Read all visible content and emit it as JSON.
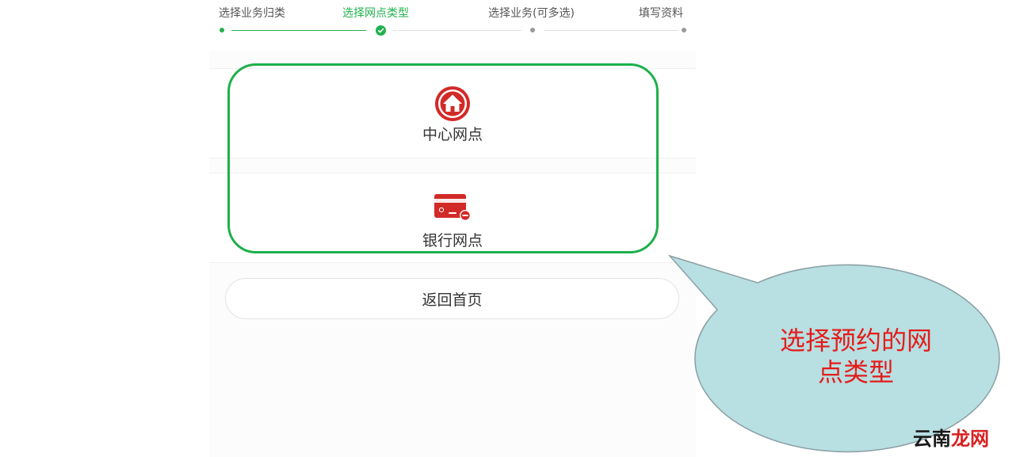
{
  "steps": [
    {
      "label": "选择业务归类",
      "state": "done"
    },
    {
      "label": "选择网点类型",
      "state": "active"
    },
    {
      "label": "选择业务(可多选)",
      "state": "pending"
    },
    {
      "label": "填写资料",
      "state": "pending"
    }
  ],
  "options": [
    {
      "label": "中心网点",
      "icon": "home-icon"
    },
    {
      "label": "银行网点",
      "icon": "bank-card-icon"
    }
  ],
  "home_button": {
    "label": "返回首页"
  },
  "annotation": {
    "text_line1": "选择预约的网",
    "text_line2": "点类型"
  },
  "watermark": {
    "part1": "云南",
    "part2": "龙网"
  },
  "colors": {
    "accent": "#22b14c",
    "icon_red": "#d22a27",
    "annotation_text": "#e51b1b",
    "bubble": "#b8dfe1"
  }
}
